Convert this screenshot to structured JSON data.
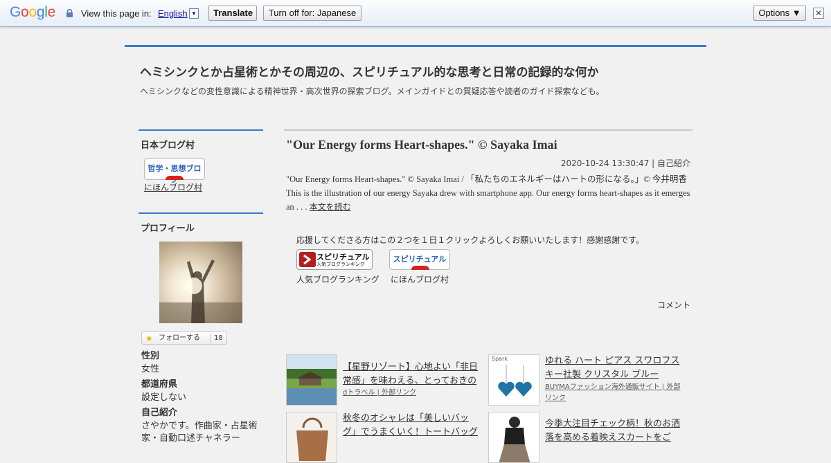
{
  "translate_bar": {
    "logo": "Google",
    "view_label": "View this page in:",
    "language": "English",
    "language_arrow": "▼",
    "translate_button": "Translate",
    "turn_off_button": "Turn off for: Japanese",
    "options_button": "Options ▼",
    "close": "✕"
  },
  "header": {
    "title": "ヘミシンクとか占星術とかその周辺の、スピリチュアル的な思考と日常の記録的な何か",
    "description": "ヘミシンクなどの変性意識による精神世界・高次世界の探索ブログ。メインガイドとの質疑応答や読者のガイド探索なども。"
  },
  "sidebar": {
    "blog_village": {
      "heading": "日本ブログ村",
      "banner_text": "哲学・思想ブログ",
      "link": "にほんブログ村"
    },
    "profile": {
      "heading": "プロフィール",
      "follow_label": "フォローする",
      "follow_count": "18",
      "gender_label": "性別",
      "gender_value": "女性",
      "pref_label": "都道府県",
      "pref_value": "設定しない",
      "intro_label": "自己紹介",
      "intro_line1": "さやかです。作曲家・占星術",
      "intro_line2": "家・自動口述チャネラー"
    }
  },
  "article": {
    "title": "\"Our Energy forms Heart-shapes.\" © Sayaka Imai",
    "meta": "2020-10-24 13:30:47 | 自己紹介",
    "body": "\"Our Energy forms Heart-shapes.\" © Sayaka Imai / 「私たちのエネルギーはハートの形になる。」© 今井明香 This is the illustration of our energy Sayaka drew with smartphone app. Our energy forms heart-shapes as it emerges an . . . ",
    "read_more": "本文を読む",
    "support_text": "応援してくださる方はこの２つを１日１クリックよろしくお願いいたします！感謝感謝です。",
    "ranking_button_text": "スピリチュアル",
    "ranking_button_sub": "人気ブログランキング",
    "ranking_caption": "人気ブログランキング",
    "village_button_text": "スピリチュアル",
    "village_caption": "にほんブログ村",
    "comment": "コメント"
  },
  "related": [
    {
      "title": "【星野リゾート】心地よい「非日常感」を味わえる、とっておきの",
      "source": "dトラベル | 外部リンク"
    },
    {
      "title": "ゆれる ハート ピアス スワロフスキー社製 クリスタル ブルー",
      "source": "BUYMAファッション海外通販サイト | 外部リンク",
      "thumb_label": "Spark"
    },
    {
      "title": "秋冬のオシャレは「美しいバッグ」でうまくいく！トートバッグ",
      "source": ""
    },
    {
      "title": "今季大注目チェック柄！秋のお洒落を高める着映えスカートをご",
      "source": ""
    }
  ],
  "colors": {
    "accent_blue": "#3b78c2",
    "background": "#f1f1f1",
    "banner_red": "#d7231e"
  }
}
